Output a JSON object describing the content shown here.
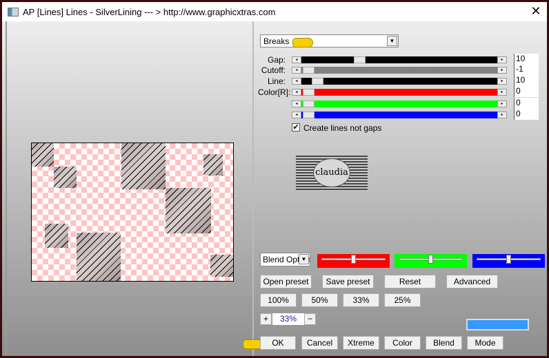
{
  "window": {
    "title": "AP [Lines]  Lines - SilverLining    --- > http://www.graphicxtras.com",
    "close_label": "✕"
  },
  "preset_dropdown": {
    "value": "Breaks"
  },
  "sliders": [
    {
      "label": "Gap:",
      "value": "10",
      "fraction": 0.28,
      "color": "#000000"
    },
    {
      "label": "Cutoff:",
      "value": "-1",
      "fraction": 0.0,
      "color": "#808080"
    },
    {
      "label": "Line:",
      "value": "10",
      "fraction": 0.05,
      "color": "#000000"
    },
    {
      "label": "Color[R]:",
      "value": "0",
      "fraction": 0.0,
      "color": "#ff0000"
    },
    {
      "label": "",
      "value": "0",
      "fraction": 0.0,
      "color": "#00ff00"
    },
    {
      "label": "",
      "value": "0",
      "fraction": 0.0,
      "color": "#0000ff"
    }
  ],
  "checkbox": {
    "label": "Create lines not gaps",
    "checked": true
  },
  "logo": {
    "text": "claudia"
  },
  "blend_dropdown": {
    "value": "Blend Options"
  },
  "color_sliders": [
    {
      "color": "#ff0000",
      "fraction": 0.5
    },
    {
      "color": "#00ff00",
      "fraction": 0.5
    },
    {
      "color": "#0000ff",
      "fraction": 0.5
    }
  ],
  "buttons": {
    "open_preset": "Open preset",
    "save_preset": "Save preset",
    "reset": "Reset",
    "advanced": "Advanced",
    "z100": "100%",
    "z50": "50%",
    "z33": "33%",
    "z25": "25%",
    "plus": "+",
    "minus": "−",
    "ok": "OK",
    "cancel": "Cancel",
    "xtreme": "Xtreme",
    "color": "Color",
    "blend": "Blend",
    "mode": "Mode"
  },
  "zoom_value": "33%",
  "color_swatch": "#3399ff"
}
